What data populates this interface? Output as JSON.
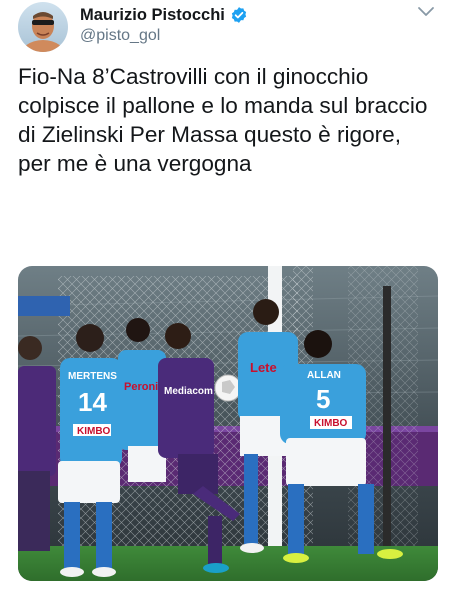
{
  "tweet": {
    "author": {
      "display_name": "Maurizio Pistocchi",
      "handle": "@pisto_gol",
      "verified": true,
      "verified_color": "#1da1f2"
    },
    "menu_icon": "chevron-down-icon",
    "text": "Fio-Na 8’Castrovilli con il ginocchio colpisce il pallone e lo manda sul braccio di Zielinski Per Massa questo è rigore,\nper me è una vergogna",
    "media": {
      "type": "photo",
      "kit_labels": [
        "MERTENS",
        "14",
        "KIMBO",
        "Lete",
        "ALLAN",
        "5",
        "KIMBO",
        "Peroni",
        "Mediacom"
      ]
    }
  }
}
